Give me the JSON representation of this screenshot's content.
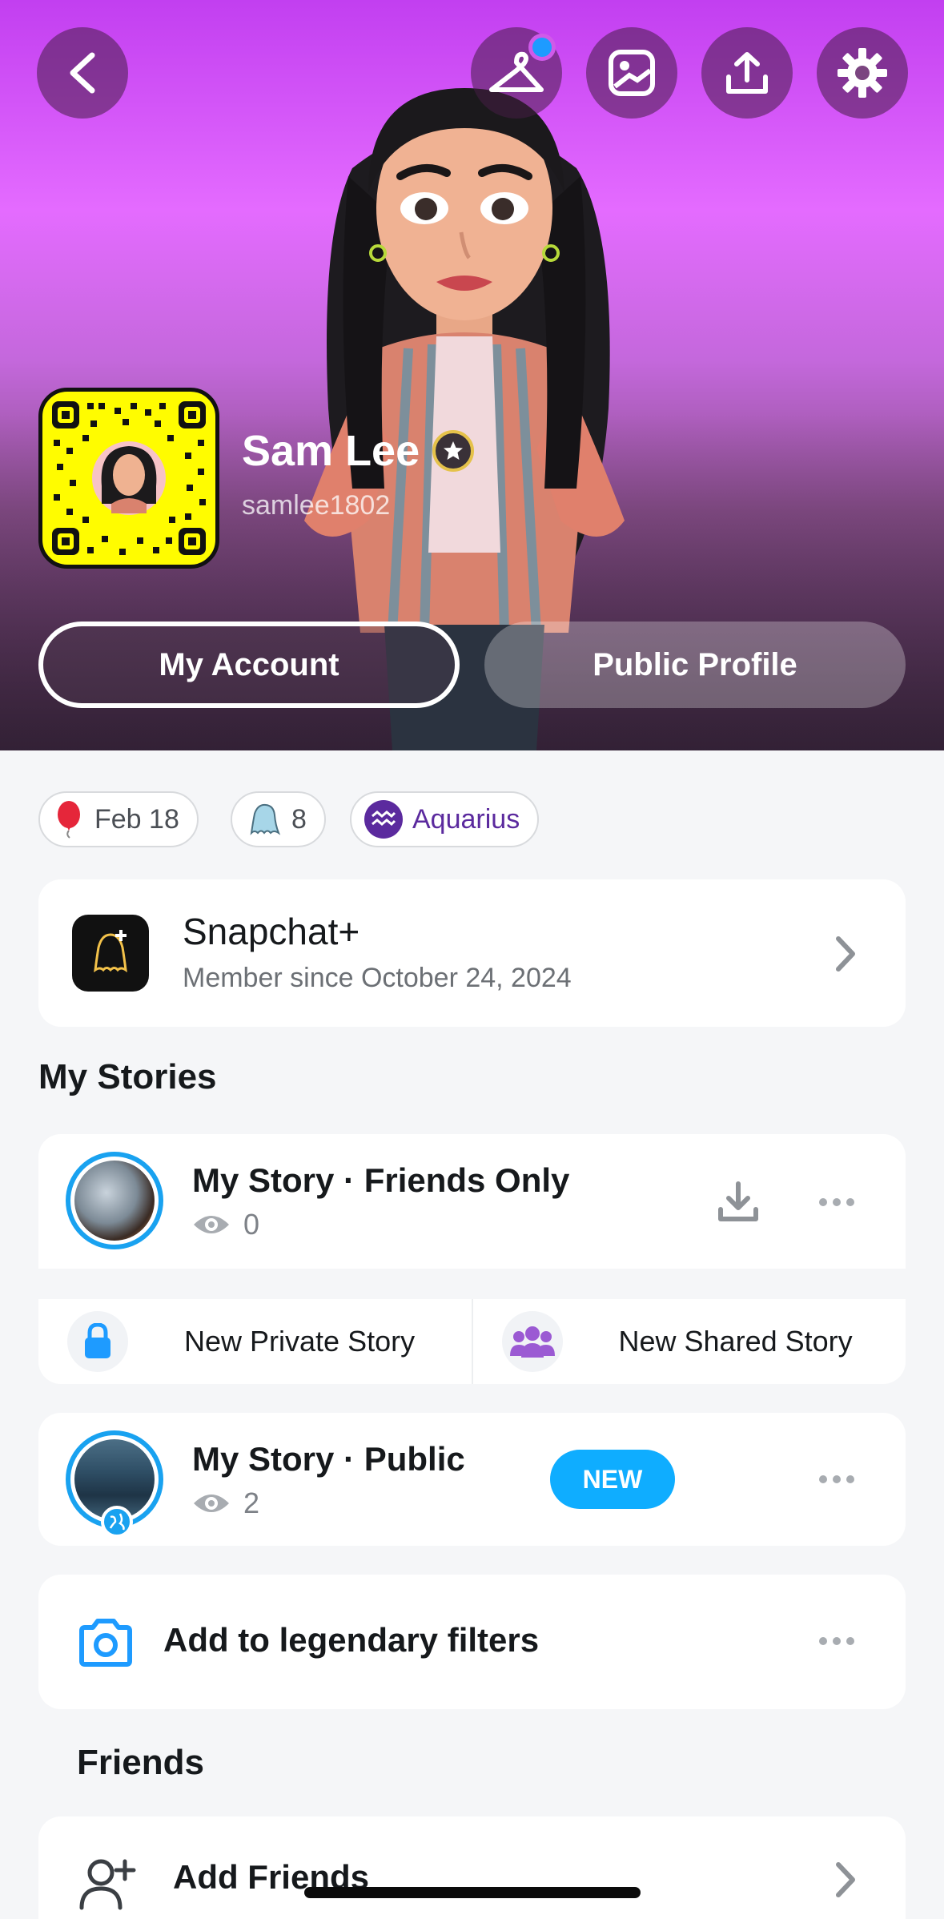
{
  "profile": {
    "display_name": "Sam Lee",
    "username": "samlee1802",
    "buttons": {
      "account": "My Account",
      "public_profile": "Public Profile"
    }
  },
  "header_icons": [
    "back-icon",
    "outfit-hanger-icon",
    "gallery-icon",
    "share-upload-icon",
    "settings-gear-icon"
  ],
  "chips": {
    "birthday": "Feb 18",
    "friends_count": "8",
    "zodiac": "Aquarius"
  },
  "snapchat_plus": {
    "title": "Snapchat+",
    "subtitle": "Member since October 24, 2024"
  },
  "my_stories": {
    "section_title": "My Stories",
    "friends_story": {
      "title": "My Story · Friends Only",
      "views": "0"
    },
    "new_private": "New Private Story",
    "new_shared": "New Shared Story",
    "public_story": {
      "title": "My Story · Public",
      "views": "2",
      "badge": "NEW"
    }
  },
  "filters": {
    "label": "Add to legendary filters"
  },
  "friends": {
    "section_title": "Friends",
    "add_friends": "Add Friends"
  },
  "colors": {
    "accent_blue": "#0fadff",
    "story_ring": "#19a2f0",
    "zodiac_purple": "#5b2a9e",
    "snapcode_yellow": "#fffc00"
  }
}
